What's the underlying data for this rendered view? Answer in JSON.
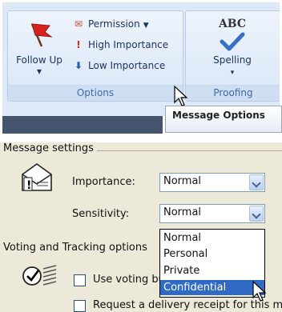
{
  "ribbon": {
    "follow_up_label": "Follow Up",
    "permission_label": "Permission",
    "high_importance_label": "High Importance",
    "low_importance_label": "Low Importance",
    "options_group_label": "Options",
    "spelling_label": "Spelling",
    "proofing_group_label": "Proofing",
    "abc_text": "ABC",
    "tooltip_text": "Message Options"
  },
  "dialog": {
    "section_title": "Message settings",
    "importance_label": "Importance:",
    "importance_value": "Normal",
    "sensitivity_label": "Sensitivity:",
    "sensitivity_value": "Normal",
    "sensitivity_options": [
      "Normal",
      "Personal",
      "Private",
      "Confidential"
    ],
    "sensitivity_highlighted": "Confidential",
    "voting_section_label": "Voting and Tracking options",
    "use_voting_label": "Use voting buttons:",
    "request_receipt_label": "Request a delivery receipt for this message"
  },
  "colors": {
    "ribbon_bg": "#dde9f7",
    "dialog_bg": "#ece9d8",
    "highlight": "#316ac5",
    "group_label": "#3e6aa8"
  },
  "icons": [
    "flag-icon",
    "permission-icon",
    "high-importance-icon",
    "low-importance-icon",
    "spelling-icon",
    "dialog-launcher-icon",
    "envelope-importance-icon",
    "voting-icon",
    "mouse-cursor-icon"
  ]
}
